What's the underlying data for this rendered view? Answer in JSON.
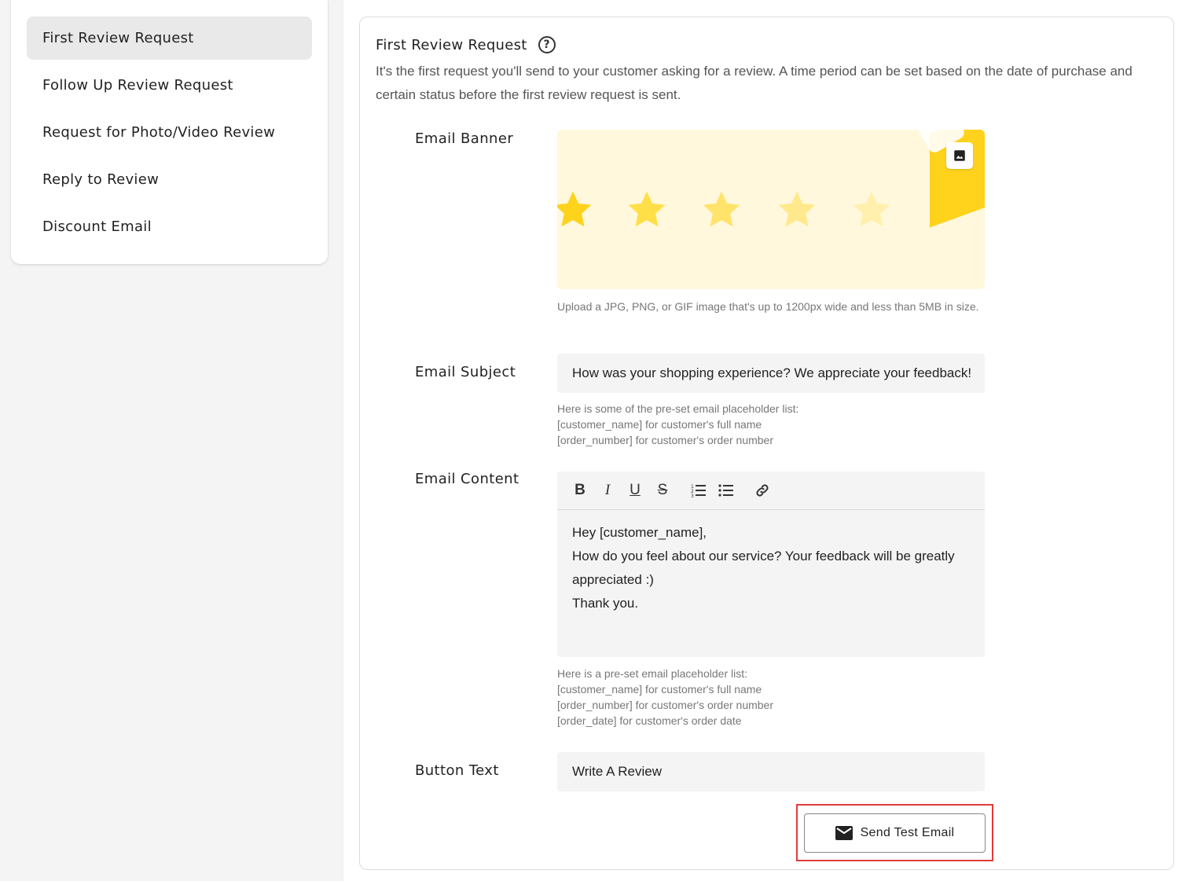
{
  "sidebar": {
    "items": [
      {
        "label": "First Review Request",
        "active": true
      },
      {
        "label": "Follow Up Review Request",
        "active": false
      },
      {
        "label": "Request for Photo/Video Review",
        "active": false
      },
      {
        "label": "Reply to Review",
        "active": false
      },
      {
        "label": "Discount Email",
        "active": false
      }
    ]
  },
  "card": {
    "title": "First Review Request",
    "help_glyph": "?",
    "description": "It's the first request you'll send to your customer asking for a review. A time period can be set based on the date of purchase and certain status before the first review request is sent."
  },
  "email_banner": {
    "label": "Email Banner",
    "hint": "Upload a JPG, PNG, or GIF image that's up to 1200px wide and less than 5MB in size."
  },
  "email_subject": {
    "label": "Email Subject",
    "value": "How was your shopping experience? We appreciate your feedback!",
    "hint_lines": [
      "Here is some of the pre-set email placeholder list:",
      "[customer_name] for customer's full name",
      "[order_number] for customer's order number"
    ]
  },
  "email_content": {
    "label": "Email Content",
    "toolbar": {
      "bold": "B",
      "italic": "I",
      "underline": "U",
      "strike": "S"
    },
    "lines": [
      "Hey [customer_name],",
      "How do you feel about our service? Your feedback will be greatly appreciated :)",
      "Thank you."
    ],
    "hint_lines": [
      "Here is a pre-set email placeholder list:",
      "[customer_name] for customer's full name",
      "[order_number] for customer's order number",
      "[order_date] for customer's order date"
    ]
  },
  "button_text": {
    "label": "Button Text",
    "value": "Write A Review"
  },
  "send_test": {
    "label": "Send Test Email",
    "icon": "mail-icon"
  },
  "colors": {
    "banner_bg": "#fff8dc",
    "star": "#ffd21c",
    "highlight_border": "#e23b3b"
  }
}
